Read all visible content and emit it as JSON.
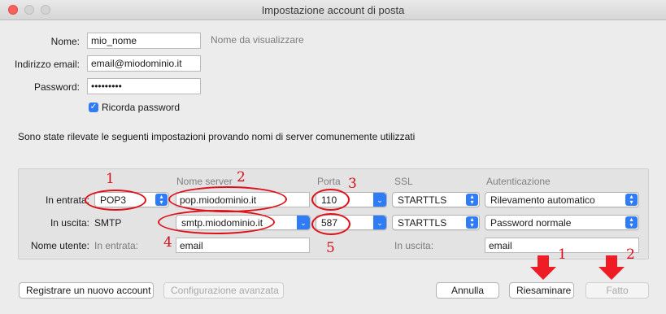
{
  "window": {
    "title": "Impostazione account di posta"
  },
  "account": {
    "name_label": "Nome:",
    "name_value": "mio_nome",
    "name_hint": "Nome da visualizzare",
    "email_label": "Indirizzo email:",
    "email_value": "email@miodominio.it",
    "password_label": "Password:",
    "password_value": "•••••••••",
    "remember_label": "Ricorda password",
    "remember_checked": true
  },
  "info_text": "Sono state rilevate le seguenti impostazioni provando nomi di server comunemente utilizzati",
  "server_table": {
    "headers": {
      "server": "Nome server",
      "port": "Porta",
      "ssl": "SSL",
      "auth": "Autenticazione"
    },
    "incoming": {
      "label": "In entrata:",
      "protocol": "POP3",
      "server": "pop.miodominio.it",
      "port": "110",
      "ssl": "STARTTLS",
      "auth": "Rilevamento automatico"
    },
    "outgoing": {
      "label": "In uscita:",
      "protocol": "SMTP",
      "server": "smtp.miodominio.it",
      "port": "587",
      "ssl": "STARTTLS",
      "auth": "Password normale"
    },
    "username": {
      "label": "Nome utente:",
      "incoming_label": "In entrata:",
      "incoming_value": "email",
      "outgoing_label": "In uscita:",
      "outgoing_value": "email"
    }
  },
  "buttons": {
    "new_account": "Registrare un nuovo account",
    "advanced": "Configurazione avanzata",
    "cancel": "Annulla",
    "retest": "Riesaminare",
    "done": "Fatto"
  },
  "annotations": {
    "protocol_num": "1",
    "server_num": "2",
    "port_num": "3",
    "username_num": "4",
    "outport_num": "5",
    "retest_num": "1",
    "done_num": "2"
  },
  "colors": {
    "annotation_red": "#e0101a",
    "accent_blue": "#2f7cf6"
  }
}
